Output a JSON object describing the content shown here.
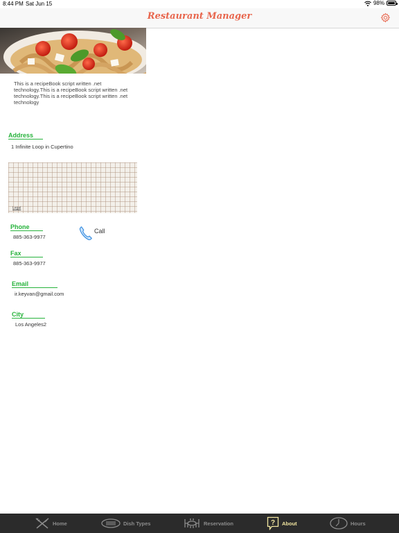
{
  "status_bar": {
    "time": "8:44 PM",
    "date": "Sat Jun 15",
    "battery": "98%",
    "battery_level": 0.98
  },
  "nav": {
    "title": "Restaurant Manager",
    "settings_icon": "gear-icon"
  },
  "about": {
    "description": "This is a recipeBook script written .net technology.This is a recipeBook script written .net technology.This is a recipeBook script written .net technology",
    "address_label": "Address",
    "address": "1 Infinite Loop in Cupertino",
    "map_legal": "Legal",
    "phone_label": "Phone",
    "phone": "885-363-9977",
    "call_label": "Call",
    "fax_label": "Fax",
    "fax": "885-363-9977",
    "email_label": "Email",
    "email": "ir.keyvan@gmail.com",
    "city_label": "City",
    "city": "Los Angeles2"
  },
  "tabs": [
    {
      "label": "Home",
      "icon": "fork-knife-icon",
      "active": false
    },
    {
      "label": "Dish Types",
      "icon": "plate-icon",
      "active": false
    },
    {
      "label": "Reservation",
      "icon": "dining-table-icon",
      "active": false
    },
    {
      "label": "About",
      "icon": "question-icon",
      "active": true
    },
    {
      "label": "Hours",
      "icon": "clock-icon",
      "active": false
    }
  ],
  "colors": {
    "accent_title": "#e8664d",
    "section_green": "#27b33c",
    "tab_bar": "#2b2b2b",
    "tab_active": "#f2e6a0"
  }
}
